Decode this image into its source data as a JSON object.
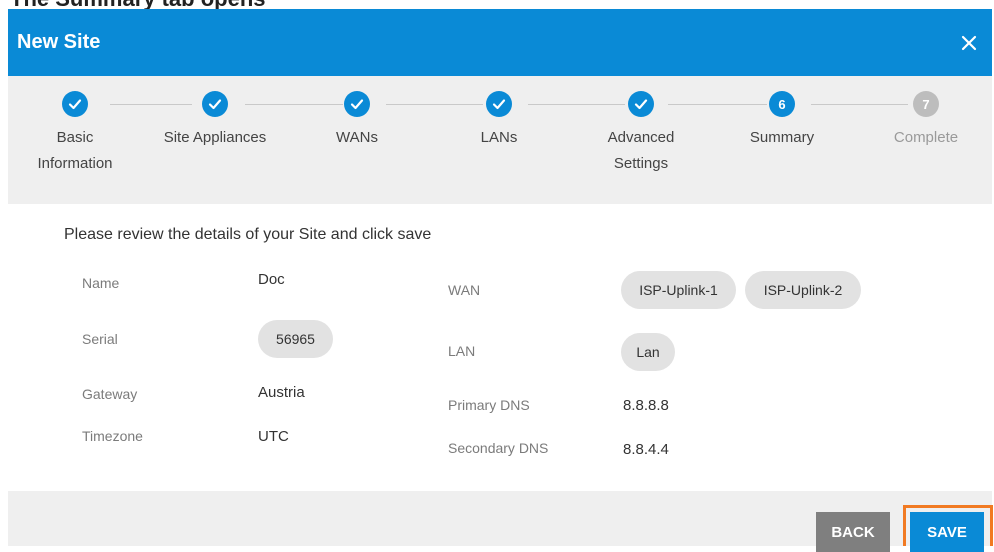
{
  "page_heading_clip": "The Summary tab opens",
  "dialog": {
    "title": "New Site",
    "close_icon": "close-icon"
  },
  "steps": [
    {
      "label": "Basic\nInformation",
      "state": "done"
    },
    {
      "label": "Site Appliances",
      "state": "done"
    },
    {
      "label": "WANs",
      "state": "done"
    },
    {
      "label": "LANs",
      "state": "done"
    },
    {
      "label": "Advanced\nSettings",
      "state": "done"
    },
    {
      "label": "Summary",
      "state": "active",
      "number": "6"
    },
    {
      "label": "Complete",
      "state": "pending",
      "number": "7"
    }
  ],
  "summary": {
    "intro": "Please review the details of your Site and click save",
    "name_label": "Name",
    "name_value": "Doc",
    "serial_label": "Serial",
    "serial_value": "56965",
    "gateway_label": "Gateway",
    "gateway_value": "Austria",
    "timezone_label": "Timezone",
    "timezone_value": "UTC",
    "wan_label": "WAN",
    "wan_values": [
      "ISP-Uplink-1",
      "ISP-Uplink-2"
    ],
    "lan_label": "LAN",
    "lan_values": [
      "Lan"
    ],
    "primary_dns_label": "Primary DNS",
    "primary_dns_value": "8.8.8.8",
    "secondary_dns_label": "Secondary DNS",
    "secondary_dns_value": "8.8.4.4"
  },
  "footer": {
    "back_label": "BACK",
    "save_label": "SAVE"
  },
  "colors": {
    "accent": "#0a8ad6",
    "pending": "#bdbdbd",
    "highlight": "#f17a22"
  }
}
